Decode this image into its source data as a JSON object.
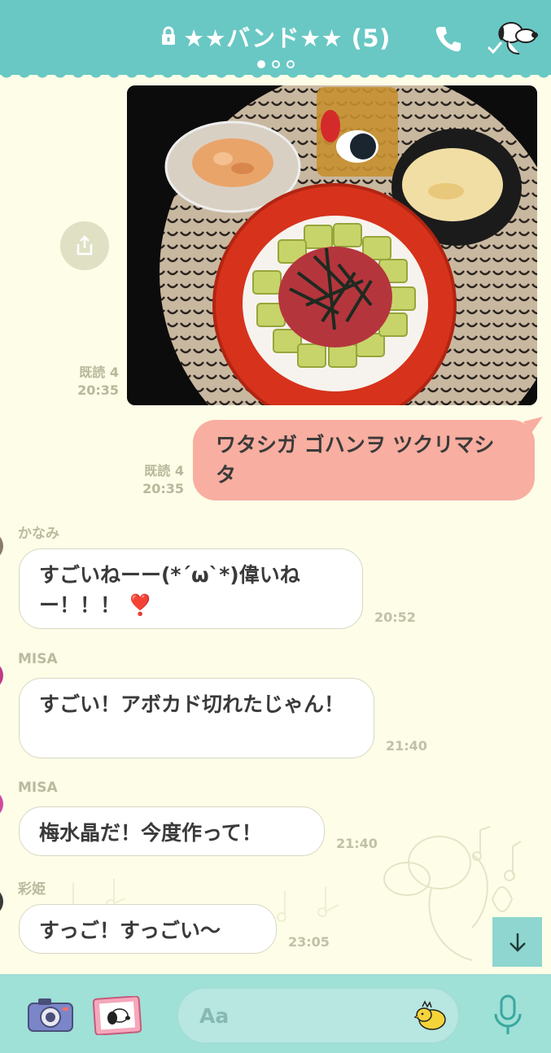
{
  "header": {
    "title": "★★バンド★★ (5)",
    "page_dots": 3,
    "active_dot": 0
  },
  "messages": {
    "photo": {
      "read": "既読 4",
      "time": "20:35"
    },
    "mine": {
      "text": "ワタシガ ゴハンヲ ツクリマシタ",
      "read": "既読 4",
      "time": "20:35"
    },
    "m1": {
      "sender": "かなみ",
      "text": "すごいねーー(*´ω`*)偉いねー！！！ ❣️",
      "time": "20:52"
    },
    "m2": {
      "sender": "MISA",
      "text": "すごい！アボカド切れたじゃん！",
      "time": "21:40"
    },
    "m3": {
      "sender": "MISA",
      "text": "梅水晶だ！今度作って！",
      "time": "21:40"
    },
    "m4": {
      "sender": "彩姫",
      "text": "すっご！すっごい〜",
      "time": "23:05"
    }
  },
  "footer": {
    "input_placeholder": "Aa"
  },
  "colors": {
    "header": "#69c8c4",
    "background": "#fdfde8",
    "my_bubble": "#f8aea0",
    "footer": "#9fe0d7"
  }
}
